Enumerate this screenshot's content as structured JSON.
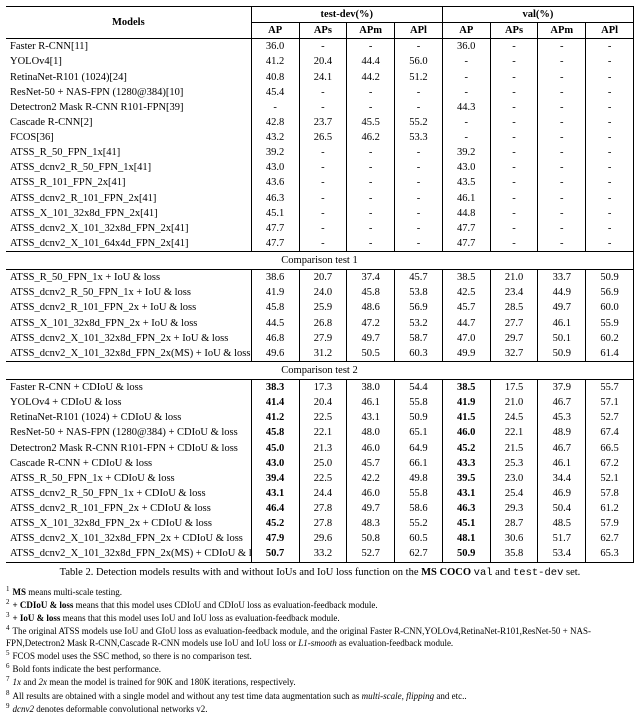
{
  "headers": {
    "models": "Models",
    "testdev": "test-dev(%)",
    "val": "val(%)",
    "AP": "AP",
    "APs": "APs",
    "APm": "APm",
    "APl": "APl"
  },
  "sections": {
    "comp1": "Comparison test 1",
    "comp2": "Comparison test 2"
  },
  "groups": [
    {
      "section": null,
      "rows": [
        {
          "m": "Faster R-CNN[11]",
          "td": [
            "36.0",
            "-",
            "-",
            "-"
          ],
          "v": [
            "36.0",
            "-",
            "-",
            "-"
          ]
        },
        {
          "m": "YOLOv4[1]",
          "td": [
            "41.2",
            "20.4",
            "44.4",
            "56.0"
          ],
          "v": [
            "-",
            "-",
            "-",
            "-"
          ]
        },
        {
          "m": "RetinaNet-R101 (1024)[24]",
          "td": [
            "40.8",
            "24.1",
            "44.2",
            "51.2"
          ],
          "v": [
            "-",
            "-",
            "-",
            "-"
          ]
        },
        {
          "m": "ResNet-50 + NAS-FPN (1280@384)[10]",
          "td": [
            "45.4",
            "-",
            "-",
            "-"
          ],
          "v": [
            "-",
            "-",
            "-",
            "-"
          ]
        },
        {
          "m": "Detectron2 Mask R-CNN R101-FPN[39]",
          "td": [
            "-",
            "-",
            "-",
            "-"
          ],
          "v": [
            "44.3",
            "-",
            "-",
            "-"
          ]
        },
        {
          "m": "Cascade R-CNN[2]",
          "td": [
            "42.8",
            "23.7",
            "45.5",
            "55.2"
          ],
          "v": [
            "-",
            "-",
            "-",
            "-"
          ]
        },
        {
          "m": "FCOS[36]",
          "td": [
            "43.2",
            "26.5",
            "46.2",
            "53.3"
          ],
          "v": [
            "-",
            "-",
            "-",
            "-"
          ]
        },
        {
          "m": "ATSS_R_50_FPN_1x[41]",
          "td": [
            "39.2",
            "-",
            "-",
            "-"
          ],
          "v": [
            "39.2",
            "-",
            "-",
            "-"
          ]
        },
        {
          "m": "ATSS_dcnv2_R_50_FPN_1x[41]",
          "td": [
            "43.0",
            "-",
            "-",
            "-"
          ],
          "v": [
            "43.0",
            "-",
            "-",
            "-"
          ]
        },
        {
          "m": "ATSS_R_101_FPN_2x[41]",
          "td": [
            "43.6",
            "-",
            "-",
            "-"
          ],
          "v": [
            "43.5",
            "-",
            "-",
            "-"
          ]
        },
        {
          "m": "ATSS_dcnv2_R_101_FPN_2x[41]",
          "td": [
            "46.3",
            "-",
            "-",
            "-"
          ],
          "v": [
            "46.1",
            "-",
            "-",
            "-"
          ]
        },
        {
          "m": "ATSS_X_101_32x8d_FPN_2x[41]",
          "td": [
            "45.1",
            "-",
            "-",
            "-"
          ],
          "v": [
            "44.8",
            "-",
            "-",
            "-"
          ]
        },
        {
          "m": "ATSS_dcnv2_X_101_32x8d_FPN_2x[41]",
          "td": [
            "47.7",
            "-",
            "-",
            "-"
          ],
          "v": [
            "47.7",
            "-",
            "-",
            "-"
          ]
        },
        {
          "m": "ATSS_dcnv2_X_101_64x4d_FPN_2x[41]",
          "td": [
            "47.7",
            "-",
            "-",
            "-"
          ],
          "v": [
            "47.7",
            "-",
            "-",
            "-"
          ]
        }
      ]
    },
    {
      "section": "comp1",
      "rows": [
        {
          "m": "ATSS_R_50_FPN_1x + IoU & loss",
          "td": [
            "38.6",
            "20.7",
            "37.4",
            "45.7"
          ],
          "v": [
            "38.5",
            "21.0",
            "33.7",
            "50.9"
          ]
        },
        {
          "m": "ATSS_dcnv2_R_50_FPN_1x + IoU & loss",
          "td": [
            "41.9",
            "24.0",
            "45.8",
            "53.8"
          ],
          "v": [
            "42.5",
            "23.4",
            "44.9",
            "56.9"
          ]
        },
        {
          "m": "ATSS_dcnv2_R_101_FPN_2x + IoU & loss",
          "td": [
            "45.8",
            "25.9",
            "48.6",
            "56.9"
          ],
          "v": [
            "45.7",
            "28.5",
            "49.7",
            "60.0"
          ]
        },
        {
          "m": "ATSS_X_101_32x8d_FPN_2x + IoU & loss",
          "td": [
            "44.5",
            "26.8",
            "47.2",
            "53.2"
          ],
          "v": [
            "44.7",
            "27.7",
            "46.1",
            "55.9"
          ]
        },
        {
          "m": "ATSS_dcnv2_X_101_32x8d_FPN_2x + IoU & loss",
          "td": [
            "46.8",
            "27.9",
            "49.7",
            "58.7"
          ],
          "v": [
            "47.0",
            "29.7",
            "50.1",
            "60.2"
          ]
        },
        {
          "m": "ATSS_dcnv2_X_101_32x8d_FPN_2x(MS) + IoU & loss",
          "td": [
            "49.6",
            "31.2",
            "50.5",
            "60.3"
          ],
          "v": [
            "49.9",
            "32.7",
            "50.9",
            "61.4"
          ]
        }
      ]
    },
    {
      "section": "comp2",
      "rows": [
        {
          "m": "Faster R-CNN + CDIoU & loss",
          "td": [
            "38.3",
            "17.3",
            "38.0",
            "54.4"
          ],
          "v": [
            "38.5",
            "17.5",
            "37.9",
            "55.7"
          ],
          "btd": [
            0
          ],
          "bv": [
            0
          ]
        },
        {
          "m": "YOLOv4 + CDIoU & loss",
          "td": [
            "41.4",
            "20.4",
            "46.1",
            "55.8"
          ],
          "v": [
            "41.9",
            "21.0",
            "46.7",
            "57.1"
          ],
          "btd": [
            0
          ],
          "bv": [
            0
          ]
        },
        {
          "m": "RetinaNet-R101 (1024) + CDIoU & loss",
          "td": [
            "41.2",
            "22.5",
            "43.1",
            "50.9"
          ],
          "v": [
            "41.5",
            "24.5",
            "45.3",
            "52.7"
          ],
          "btd": [
            0
          ],
          "bv": [
            0
          ]
        },
        {
          "m": "ResNet-50 + NAS-FPN (1280@384) + CDIoU & loss",
          "td": [
            "45.8",
            "22.1",
            "48.0",
            "65.1"
          ],
          "v": [
            "46.0",
            "22.1",
            "48.9",
            "67.4"
          ],
          "btd": [
            0
          ],
          "bv": [
            0
          ]
        },
        {
          "m": "Detectron2 Mask R-CNN R101-FPN + CDIoU & loss",
          "td": [
            "45.0",
            "21.3",
            "46.0",
            "64.9"
          ],
          "v": [
            "45.2",
            "21.5",
            "46.7",
            "66.5"
          ],
          "btd": [
            0
          ],
          "bv": [
            0
          ]
        },
        {
          "m": "Cascade R-CNN + CDIoU & loss",
          "td": [
            "43.0",
            "25.0",
            "45.7",
            "66.1"
          ],
          "v": [
            "43.3",
            "25.3",
            "46.1",
            "67.2"
          ],
          "btd": [
            0
          ],
          "bv": [
            0
          ]
        },
        {
          "m": "ATSS_R_50_FPN_1x + CDIoU & loss",
          "td": [
            "39.4",
            "22.5",
            "42.2",
            "49.8"
          ],
          "v": [
            "39.5",
            "23.0",
            "34.4",
            "52.1"
          ],
          "btd": [
            0
          ],
          "bv": [
            0
          ]
        },
        {
          "m": "ATSS_dcnv2_R_50_FPN_1x + CDIoU & loss",
          "td": [
            "43.1",
            "24.4",
            "46.0",
            "55.8"
          ],
          "v": [
            "43.1",
            "25.4",
            "46.9",
            "57.8"
          ],
          "btd": [
            0
          ],
          "bv": [
            0
          ]
        },
        {
          "m": "ATSS_dcnv2_R_101_FPN_2x + CDIoU & loss",
          "td": [
            "46.4",
            "27.8",
            "49.7",
            "58.6"
          ],
          "v": [
            "46.3",
            "29.3",
            "50.4",
            "61.2"
          ],
          "btd": [
            0
          ],
          "bv": [
            0
          ]
        },
        {
          "m": "ATSS_X_101_32x8d_FPN_2x + CDIoU & loss",
          "td": [
            "45.2",
            "27.8",
            "48.3",
            "55.2"
          ],
          "v": [
            "45.1",
            "28.7",
            "48.5",
            "57.9"
          ],
          "btd": [
            0
          ],
          "bv": [
            0
          ]
        },
        {
          "m": "ATSS_dcnv2_X_101_32x8d_FPN_2x + CDIoU & loss",
          "td": [
            "47.9",
            "29.6",
            "50.8",
            "60.5"
          ],
          "v": [
            "48.1",
            "30.6",
            "51.7",
            "62.7"
          ],
          "btd": [
            0
          ],
          "bv": [
            0
          ]
        },
        {
          "m": "ATSS_dcnv2_X_101_32x8d_FPN_2x(MS) + CDIoU & loss",
          "td": [
            "50.7",
            "33.2",
            "52.7",
            "62.7"
          ],
          "v": [
            "50.9",
            "35.8",
            "53.4",
            "65.3"
          ],
          "btd": [
            0
          ],
          "bv": [
            0
          ]
        }
      ]
    }
  ],
  "caption_parts": {
    "pre": "Table 2. Detection models results with and without IoUs and IoU loss function on the ",
    "bold1": "MS COCO",
    "mid1": " ",
    "code1": "val",
    "mid2": " and ",
    "code2": "test-dev",
    "post": " set."
  },
  "footnotes": [
    {
      "n": "1",
      "pre": "",
      "b": "MS",
      "post": " means multi-scale testing."
    },
    {
      "n": "2",
      "pre": "",
      "b": "+ CDIoU & loss",
      "post": " means that this model uses CDIoU and CDIoU loss as evaluation-feedback module."
    },
    {
      "n": "3",
      "pre": "",
      "b": "+ IoU & loss",
      "post": " means that this model uses IoU and IoU loss as evaluation-feedback module."
    },
    {
      "n": "4",
      "pre": "The original ATSS models use IoU and GIoU loss as evaluation-feedback module, and the original Faster R-CNN,YOLOv4,RetinaNet-R101,ResNet-50 + NAS-FPN,Detectron2 Mask R-CNN,Cascade R-CNN models use IoU and IoU loss or ",
      "i": "L1-smooth",
      "post": " as evaluation-feedback module."
    },
    {
      "n": "5",
      "pre": "FCOS model uses the SSC method, so there is no comparison test.",
      "b": "",
      "post": ""
    },
    {
      "n": "6",
      "pre": "Bold fonts indicate the best performance.",
      "b": "",
      "post": ""
    },
    {
      "n": "7",
      "pre": "",
      "i": "1x",
      "mid": " and ",
      "i2": "2x",
      "post": " mean the model is trained for 90K and 180K iterations, respectively."
    },
    {
      "n": "8",
      "pre": "All results are obtained with a single model and without any test time data augmentation such as ",
      "i": "multi-scale, flipping",
      "post": " and etc.."
    },
    {
      "n": "9",
      "pre": "",
      "i": "dcnv2",
      "post": " denotes deformable convolutional networks v2."
    }
  ]
}
